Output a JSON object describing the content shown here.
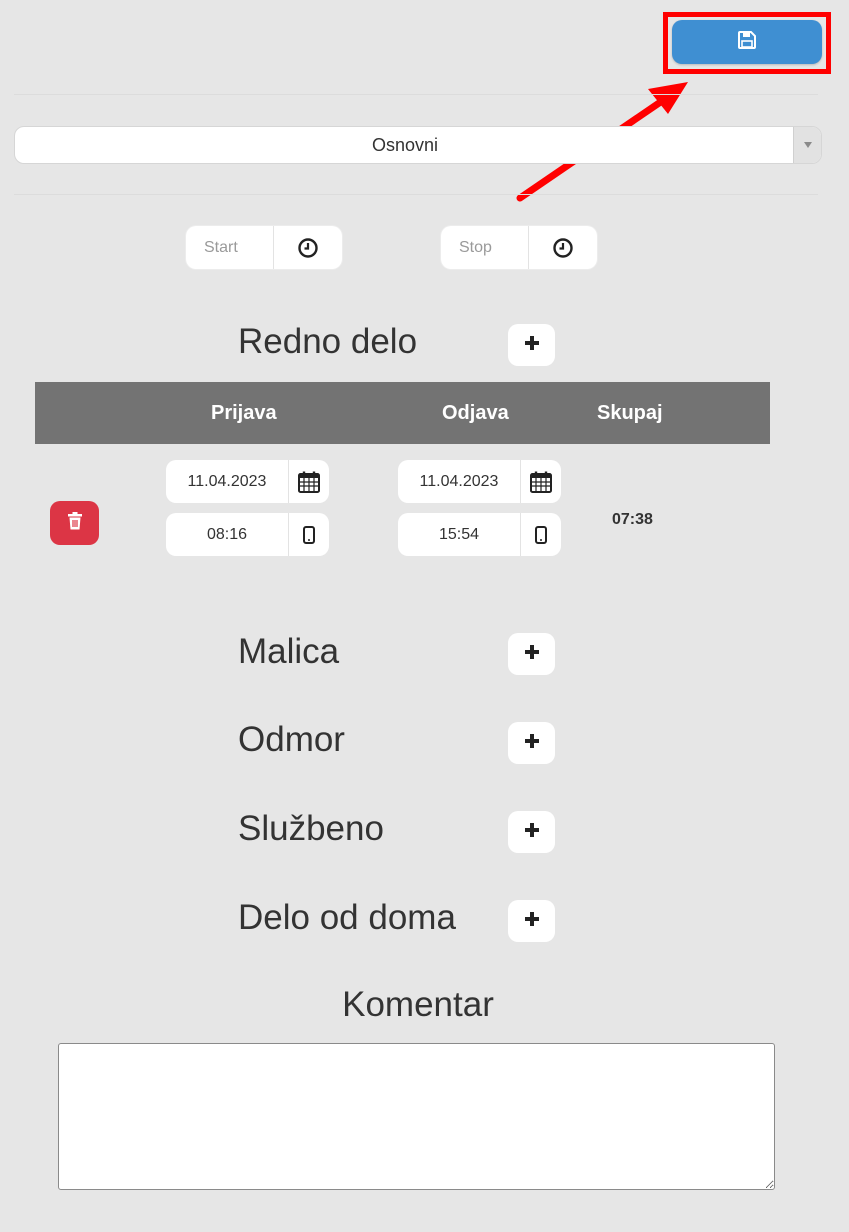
{
  "toolbar": {
    "save_icon": "floppy-disk-icon"
  },
  "select": {
    "value": "Osnovni",
    "arrow_icon": "caret-down-icon"
  },
  "time_controls": {
    "start_placeholder": "Start",
    "stop_placeholder": "Stop",
    "clock_icon": "clock-icon"
  },
  "sections": {
    "redno_delo": "Redno delo",
    "malica": "Malica",
    "odmor": "Odmor",
    "sluzbeno": "Službeno",
    "delo_od_doma": "Delo od doma"
  },
  "table": {
    "headers": {
      "prijava": "Prijava",
      "odjava": "Odjava",
      "skupaj": "Skupaj"
    },
    "rows": [
      {
        "prijava_date": "11.04.2023",
        "prijava_time": "08:16",
        "odjava_date": "11.04.2023",
        "odjava_time": "15:54",
        "skupaj": "07:38"
      }
    ]
  },
  "comment": {
    "title": "Komentar",
    "value": ""
  },
  "colors": {
    "background": "#e6e6e6",
    "save_button": "#3f8fd2",
    "delete_button": "#dc3545",
    "table_header": "#737373",
    "highlight": "#ff0000"
  }
}
